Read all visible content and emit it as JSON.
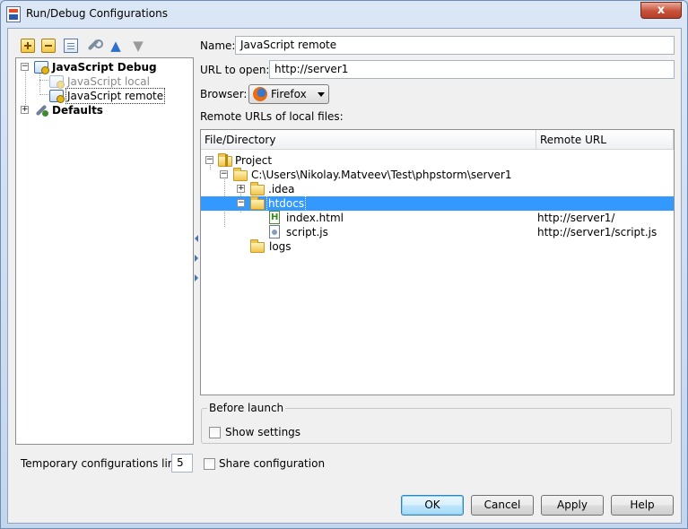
{
  "window": {
    "title": "Run/Debug Configurations",
    "close_glyph": "x"
  },
  "toolbar": {
    "add_icon": "add-icon",
    "remove_icon": "remove-icon",
    "copy_icon": "copy-icon",
    "edit_defaults_icon": "wrench-icon",
    "move_up_icon": "arrow-up-icon",
    "move_down_icon": "arrow-down-icon"
  },
  "config_tree": {
    "group_label": "JavaScript Debug",
    "items": [
      {
        "label": "JavaScript local",
        "disabled": true
      },
      {
        "label": "JavaScript remote",
        "selected": true
      }
    ],
    "defaults_label": "Defaults",
    "expand_glyph": "+",
    "collapse_glyph": "−"
  },
  "temp_limit": {
    "label": "Temporary configurations limit:",
    "value": "5"
  },
  "form": {
    "name_label": "Name:",
    "name_value": "JavaScript remote",
    "url_label": "URL to open:",
    "url_value": "http://server1",
    "browser_label": "Browser:",
    "browser_value": "Firefox",
    "remote_urls_label": "Remote URLs of local files:"
  },
  "files_table": {
    "columns": [
      "File/Directory",
      "Remote URL"
    ],
    "rows": [
      {
        "name": "Project",
        "remote_url": "",
        "icon": "project-folder-icon"
      },
      {
        "name": "C:\\Users\\Nikolay.Matveev\\Test\\phpstorm\\server1",
        "remote_url": "",
        "icon": "folder-open-icon"
      },
      {
        "name": ".idea",
        "remote_url": "",
        "icon": "folder-icon"
      },
      {
        "name": "htdocs",
        "remote_url": "",
        "icon": "folder-open-icon",
        "selected": true
      },
      {
        "name": "index.html",
        "remote_url": "http://server1/",
        "icon": "html-file-icon"
      },
      {
        "name": "script.js",
        "remote_url": "http://server1/script.js",
        "icon": "js-file-icon"
      },
      {
        "name": "logs",
        "remote_url": "",
        "icon": "folder-icon"
      }
    ]
  },
  "before_launch": {
    "title": "Before launch",
    "show_settings_label": "Show settings",
    "show_settings_checked": false
  },
  "share": {
    "label": "Share configuration",
    "checked": false
  },
  "buttons": {
    "ok": "OK",
    "cancel": "Cancel",
    "apply": "Apply",
    "help": "Help"
  },
  "colors": {
    "selection": "#3399ff",
    "close_button": "#c75239",
    "titlebar": "#c3d6ee"
  }
}
